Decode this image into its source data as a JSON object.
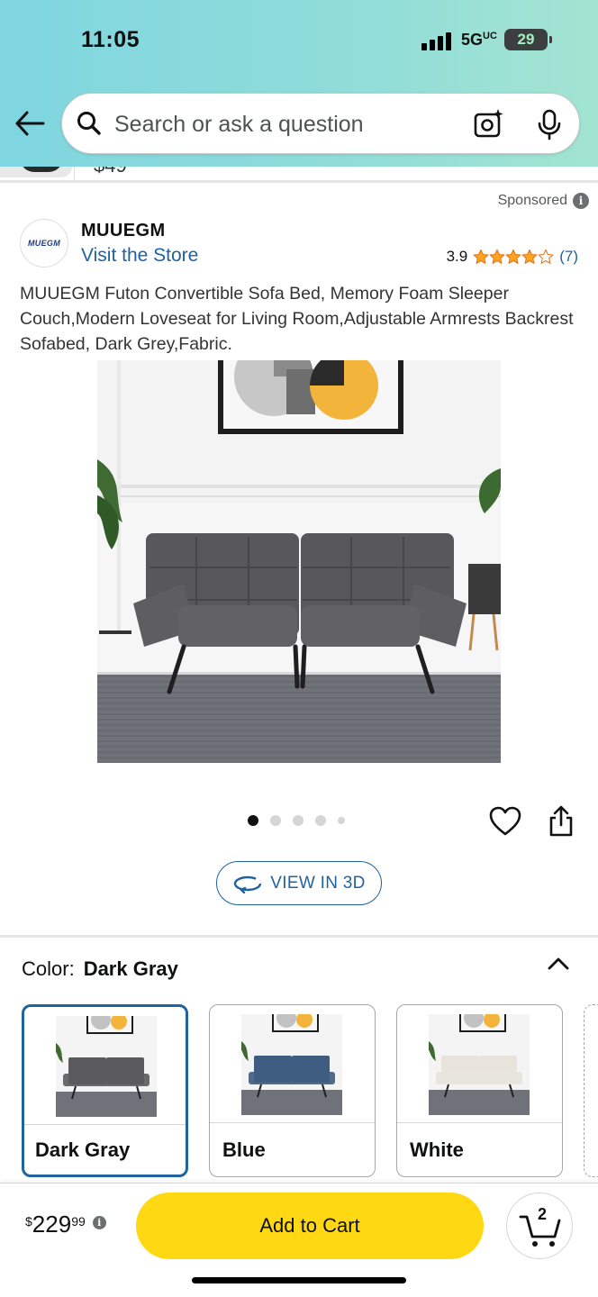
{
  "status_bar": {
    "time": "11:05",
    "network": "5G",
    "battery": "29"
  },
  "search": {
    "placeholder": "Search or ask a question"
  },
  "previous_item": {
    "price_fragment": "$49"
  },
  "ad": {
    "sponsored_label": "Sponsored",
    "brand_logo_text": "MUEGM",
    "brand_name": "MUUEGM",
    "store_link": "Visit the Store",
    "rating_value": "3.9",
    "rating_stars": 3.9,
    "rating_count": "(7)",
    "title": "MUUEGM Futon Convertible Sofa Bed, Memory Foam Sleeper Couch,Modern Loveseat for Living Room,Adjustable Armrests Backrest Sofabed, Dark Grey,Fabric."
  },
  "gallery": {
    "image_count": 5,
    "current_index": 1,
    "view_3d_label": "VIEW IN 3D"
  },
  "color_selector": {
    "label": "Color:",
    "selected": "Dark Gray",
    "options": [
      {
        "name": "Dark Gray",
        "swatch_color": "#5b5b5e",
        "selected": true
      },
      {
        "name": "Blue",
        "swatch_color": "#3f5d80",
        "selected": false
      },
      {
        "name": "White",
        "swatch_color": "#e8e4dc",
        "selected": false
      }
    ]
  },
  "buy_bar": {
    "currency": "$",
    "price_whole": "229",
    "price_fraction": "99",
    "add_to_cart_label": "Add to Cart",
    "cart_count": "2"
  },
  "colors": {
    "link": "#2162a1",
    "add_to_cart": "#ffd814",
    "star": "#ffa41c"
  }
}
